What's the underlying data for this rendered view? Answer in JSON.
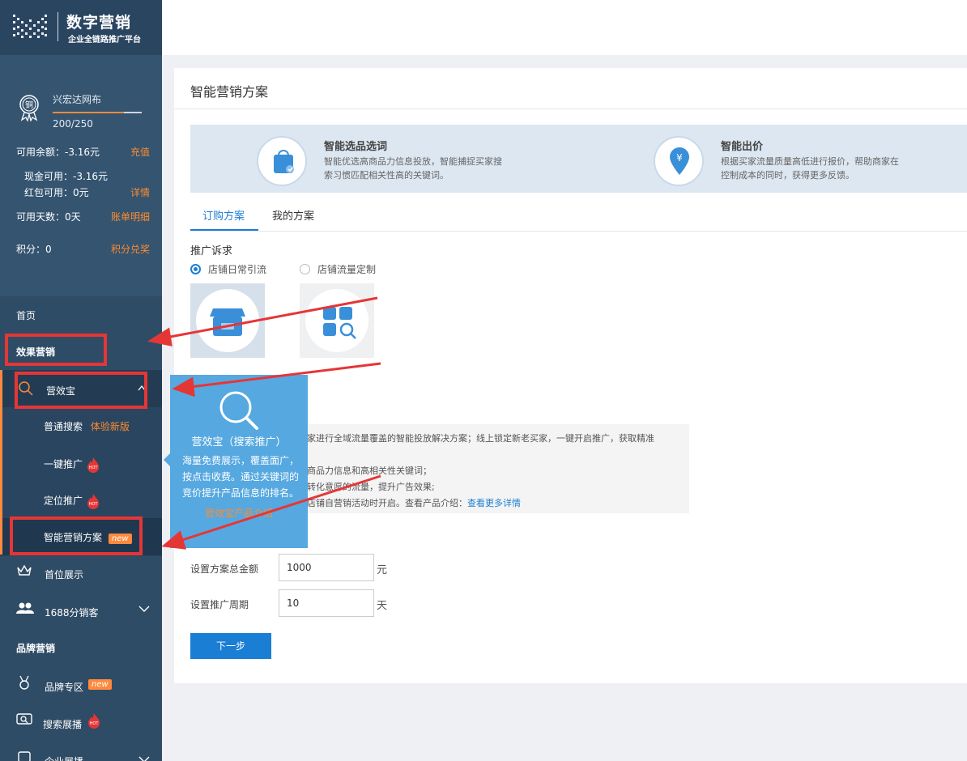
{
  "logo": {
    "title": "数字营销",
    "subtitle": "企业全链路推广平台"
  },
  "account": {
    "medal_char": "铜",
    "name": "兴宏达网布",
    "score": "200/250",
    "progress": 0.8,
    "balance_label": "可用余额：-3.16元",
    "recharge": "充值",
    "cash_label": "现金可用：-3.16元",
    "redpacket_label": "红包可用：0元",
    "detail": "详情",
    "days_label": "可用天数：0天",
    "bill_link": "账单明细",
    "points_label": "积分：0",
    "points_link": "积分兑奖"
  },
  "nav": {
    "home": "首页",
    "effect_marketing": "效果营销",
    "yingxiaobao": "营效宝",
    "normal_search": "普通搜索",
    "normal_search_tag": "体验新版",
    "one_click": "一键推广",
    "positioning": "定位推广",
    "smart_plan": "智能营销方案",
    "new_tag": "new",
    "hot_tag": "HOT",
    "top_display": "首位展示",
    "distribution": "1688分销客",
    "brand_marketing": "品牌营销",
    "brand_zone": "品牌专区",
    "search_showcase": "搜索展播",
    "enterprise_showcase": "企业展播"
  },
  "main": {
    "title": "智能营销方案",
    "features": [
      {
        "title": "智能选品选词",
        "desc": "智能优选高商品力信息投放，智能捕捉买家搜索习惯匹配相关性高的关键词。",
        "icon": "bag-icon"
      },
      {
        "title": "智能出价",
        "desc": "根据买家流量质量高低进行报价，帮助商家在控制成本的同时，获得更多反馈。",
        "icon": "yuan-pin-icon"
      }
    ],
    "tabs": [
      "订购方案",
      "我的方案"
    ],
    "goal_label": "推广诉求",
    "options": [
      "店铺日常引流",
      "店铺流量定制"
    ],
    "selected_option": 0,
    "desc_lines": [
      "家进行全域流量覆盖的智能投放解决方案；线上锁定新老买家，一键开启推广，获取精准",
      "商品力信息和高相关性关键词；",
      "转化意愿的流量，提升广告效果;",
      "店铺自营销活动时开启。查看产品介绍："
    ],
    "desc_link": "查看更多详情",
    "budget_label": "设置方案总金额",
    "budget_value": "1000",
    "budget_unit": "元",
    "period_label": "设置推广周期",
    "period_value": "10",
    "period_unit": "天",
    "next_button": "下一步"
  },
  "popover": {
    "title": "营效宝（搜索推广）",
    "body": "海量免费展示，覆盖面广，按点击收费。通过关键词的竞价提升产品信息的排名。",
    "link": "营效宝产品介绍"
  },
  "colors": {
    "sidebar": "#2f4c66",
    "accent": "#ff8a3d",
    "primary": "#1a7ed4",
    "annotation": "#e53636"
  }
}
